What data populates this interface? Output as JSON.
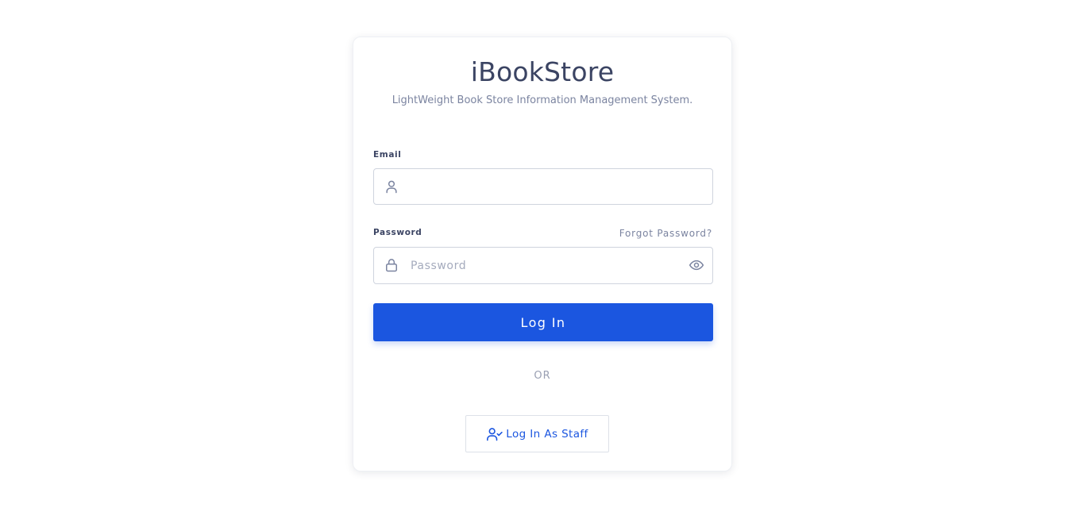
{
  "app": {
    "title": "iBookStore",
    "subtitle": "LightWeight Book Store Information Management System."
  },
  "form": {
    "email": {
      "label": "Email",
      "value": "",
      "placeholder": "",
      "icon": "user-icon"
    },
    "password": {
      "label": "Password",
      "value": "",
      "placeholder": "Password",
      "icon": "lock-icon",
      "toggle_icon": "eye-icon",
      "forgot_label": "Forgot Password?"
    },
    "submit_label": "Log In",
    "divider_label": "OR",
    "staff_button": {
      "label": "Log In As Staff",
      "icon": "user-check-icon"
    }
  },
  "colors": {
    "accent": "#1b56e0",
    "title_text": "#3b4463",
    "muted_text": "#7b84a0",
    "border": "#cfd4de"
  }
}
